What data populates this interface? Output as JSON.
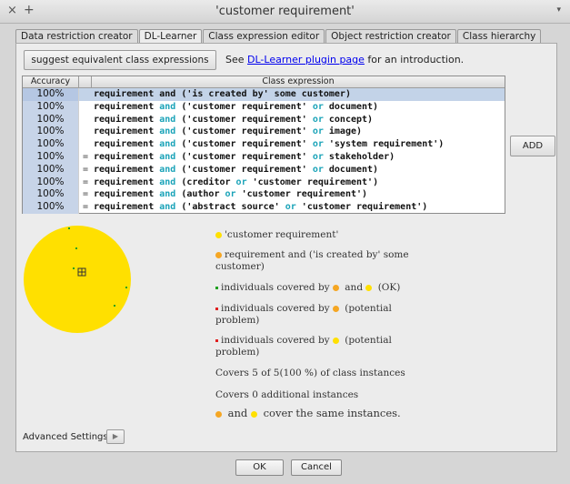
{
  "window": {
    "title": "'customer requirement'",
    "close_glyph": "×",
    "plus_glyph": "+",
    "menu_glyph": "▾"
  },
  "tabs": [
    {
      "label": "Data restriction creator",
      "active": false
    },
    {
      "label": "DL-Learner",
      "active": true
    },
    {
      "label": "Class expression editor",
      "active": false
    },
    {
      "label": "Object restriction creator",
      "active": false
    },
    {
      "label": "Class hierarchy",
      "active": false
    }
  ],
  "toolbar": {
    "suggest_label": "suggest equivalent class expressions",
    "see_prefix": "See ",
    "link_text": "DL-Learner plugin page",
    "see_suffix": " for an introduction."
  },
  "table": {
    "headers": {
      "accuracy": "Accuracy",
      "expression": "Class expression"
    },
    "rows": [
      {
        "accuracy": "100%",
        "mark": "",
        "selected": true,
        "parts": [
          [
            "requirement and ('is created by' some customer)",
            false
          ]
        ]
      },
      {
        "accuracy": "100%",
        "mark": "",
        "selected": false,
        "parts": [
          [
            "requirement ",
            false
          ],
          [
            "and",
            true
          ],
          [
            " ('customer requirement' ",
            false
          ],
          [
            "or",
            true
          ],
          [
            " document)",
            false
          ]
        ]
      },
      {
        "accuracy": "100%",
        "mark": "",
        "selected": false,
        "parts": [
          [
            "requirement ",
            false
          ],
          [
            "and",
            true
          ],
          [
            " ('customer requirement' ",
            false
          ],
          [
            "or",
            true
          ],
          [
            " concept)",
            false
          ]
        ]
      },
      {
        "accuracy": "100%",
        "mark": "",
        "selected": false,
        "parts": [
          [
            "requirement ",
            false
          ],
          [
            "and",
            true
          ],
          [
            " ('customer requirement' ",
            false
          ],
          [
            "or",
            true
          ],
          [
            " image)",
            false
          ]
        ]
      },
      {
        "accuracy": "100%",
        "mark": "",
        "selected": false,
        "parts": [
          [
            "requirement ",
            false
          ],
          [
            "and",
            true
          ],
          [
            " ('customer requirement' ",
            false
          ],
          [
            "or",
            true
          ],
          [
            " 'system requirement')",
            false
          ]
        ]
      },
      {
        "accuracy": "100%",
        "mark": "=",
        "selected": false,
        "parts": [
          [
            "requirement ",
            false
          ],
          [
            "and",
            true
          ],
          [
            " ('customer requirement' ",
            false
          ],
          [
            "or",
            true
          ],
          [
            " stakeholder)",
            false
          ]
        ]
      },
      {
        "accuracy": "100%",
        "mark": "=",
        "selected": false,
        "parts": [
          [
            "requirement ",
            false
          ],
          [
            "and",
            true
          ],
          [
            " ('customer requirement' ",
            false
          ],
          [
            "or",
            true
          ],
          [
            " document)",
            false
          ]
        ]
      },
      {
        "accuracy": "100%",
        "mark": "=",
        "selected": false,
        "parts": [
          [
            "requirement ",
            false
          ],
          [
            "and",
            true
          ],
          [
            " (creditor ",
            false
          ],
          [
            "or",
            true
          ],
          [
            " 'customer requirement')",
            false
          ]
        ]
      },
      {
        "accuracy": "100%",
        "mark": "=",
        "selected": false,
        "parts": [
          [
            "requirement ",
            false
          ],
          [
            "and",
            true
          ],
          [
            " (author ",
            false
          ],
          [
            "or",
            true
          ],
          [
            " 'customer requirement')",
            false
          ]
        ]
      },
      {
        "accuracy": "100%",
        "mark": "=",
        "selected": false,
        "parts": [
          [
            "requirement ",
            false
          ],
          [
            "and",
            true
          ],
          [
            " ('abstract source' ",
            false
          ],
          [
            "or",
            true
          ],
          [
            " 'customer requirement')",
            false
          ]
        ]
      }
    ]
  },
  "add_label": "ADD",
  "legend": {
    "class_name": "'customer requirement'",
    "suggestion": "requirement and ('is created by' some customer)",
    "covered_both_prefix": "individuals covered by ",
    "covered_both_mid": " and ",
    "covered_both_suffix": " (OK)",
    "covered_orange_prefix": "individuals covered by ",
    "covered_orange_suffix": " (potential problem)",
    "covered_yellow_prefix": "individuals covered by ",
    "covered_yellow_suffix": " (potential problem)",
    "coverage": "Covers 5 of 5(100 %) of class instances",
    "additional": "Covers 0 additional instances",
    "same_mid": " and ",
    "same_suffix": " cover the same instances."
  },
  "advanced": {
    "label": "Advanced Settings",
    "glyph": "▶"
  },
  "buttons": {
    "ok": "OK",
    "cancel": "Cancel"
  },
  "colors": {
    "class_circle": "#ffe000",
    "suggestion": "#f5a623",
    "ok_point": "#20a020",
    "problem_point": "#e02020"
  }
}
